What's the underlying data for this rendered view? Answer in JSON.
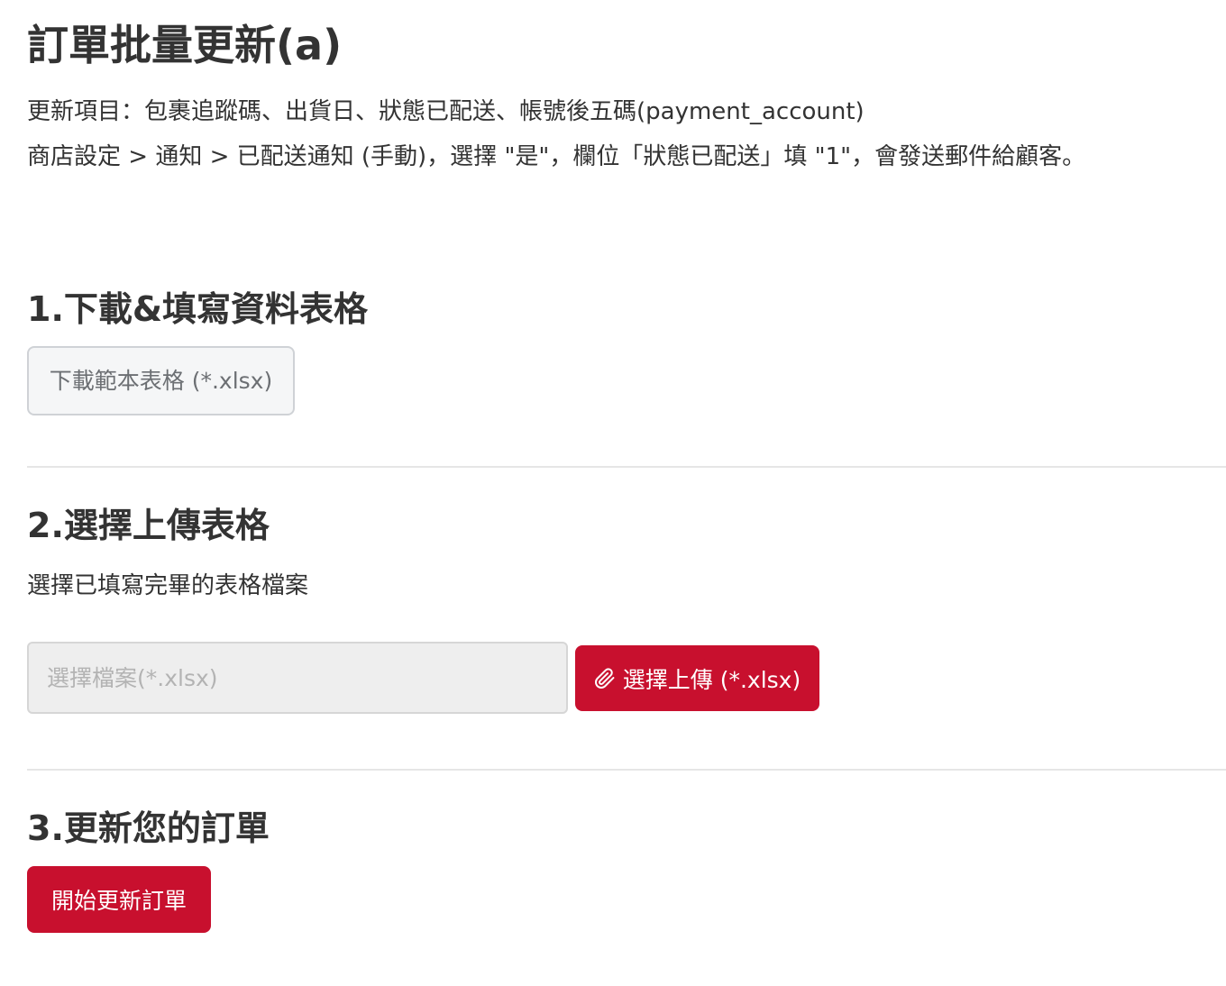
{
  "page": {
    "title": "訂單批量更新(a)",
    "description_line1": "更新項目：包裹追蹤碼、出貨日、狀態已配送、帳號後五碼(payment_account)",
    "description_line2": "商店設定 > 通知 > 已配送通知 (手動)，選擇 \"是\"，欄位「狀態已配送」填 \"1\"，會發送郵件給顧客。"
  },
  "step1": {
    "title": "1.下載&填寫資料表格",
    "download_button": "下載範本表格 (*.xlsx)"
  },
  "step2": {
    "title": "2.選擇上傳表格",
    "helper_text": "選擇已填寫完畢的表格檔案",
    "file_placeholder": "選擇檔案(*.xlsx)",
    "upload_button": "選擇上傳 (*.xlsx)",
    "upload_icon": "paperclip-icon"
  },
  "step3": {
    "title": "3.更新您的訂單",
    "start_button": "開始更新訂單"
  },
  "colors": {
    "primary": "#c8102e",
    "text": "#333333",
    "secondary_button_bg": "#f5f6f7",
    "input_bg": "#eeeeee"
  }
}
